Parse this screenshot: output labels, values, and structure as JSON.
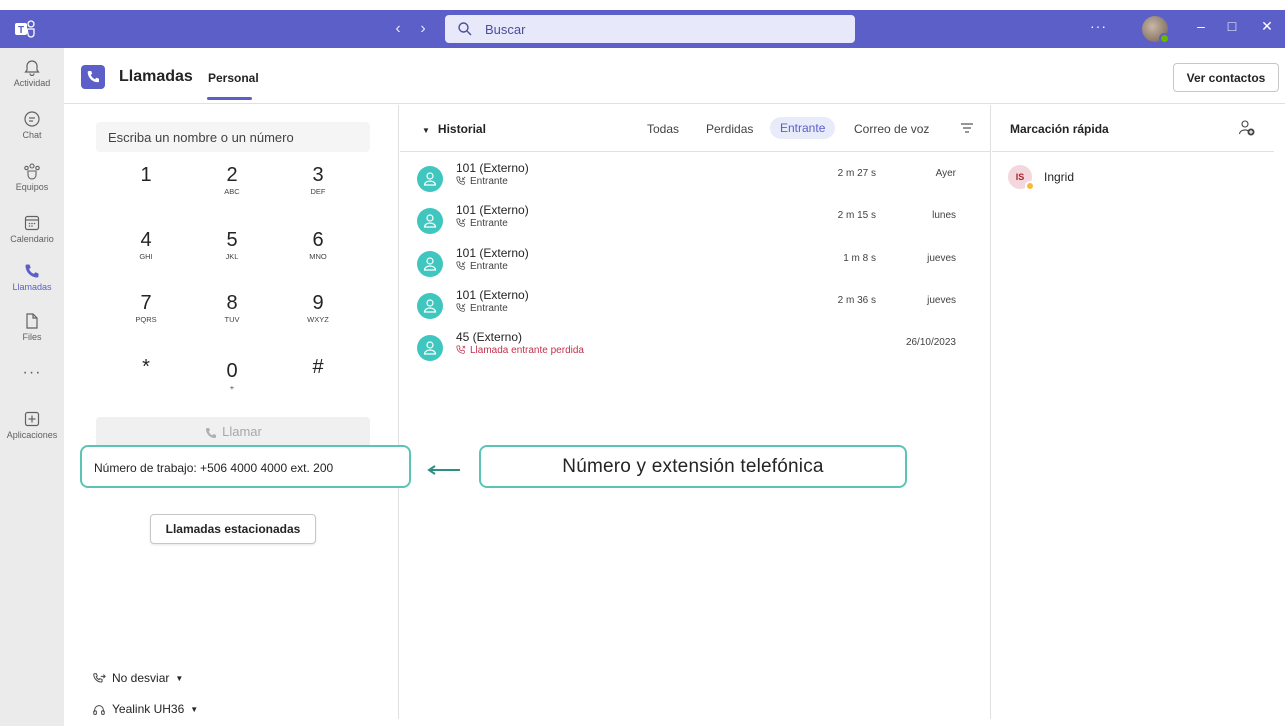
{
  "titlebar": {
    "search_placeholder": "Buscar",
    "more_label": "···",
    "minimize": "–",
    "maximize": "□",
    "close": "✕"
  },
  "rail": {
    "items": [
      {
        "label": "Actividad",
        "icon": "bell-icon"
      },
      {
        "label": "Chat",
        "icon": "chat-icon"
      },
      {
        "label": "Equipos",
        "icon": "teams-icon"
      },
      {
        "label": "Calendario",
        "icon": "calendar-icon"
      },
      {
        "label": "Llamadas",
        "icon": "phone-icon",
        "active": true
      },
      {
        "label": "Files",
        "icon": "file-icon"
      },
      {
        "label": "Aplicaciones",
        "icon": "add-app-icon"
      }
    ],
    "more_label": "···"
  },
  "header": {
    "title": "Llamadas",
    "tab": "Personal",
    "contacts_button": "Ver contactos"
  },
  "dialer": {
    "input_placeholder": "Escriba un nombre o un número",
    "keys": [
      {
        "digit": "1",
        "letters": ""
      },
      {
        "digit": "2",
        "letters": "ABC"
      },
      {
        "digit": "3",
        "letters": "DEF"
      },
      {
        "digit": "4",
        "letters": "GHI"
      },
      {
        "digit": "5",
        "letters": "JKL"
      },
      {
        "digit": "6",
        "letters": "MNO"
      },
      {
        "digit": "7",
        "letters": "PQRS"
      },
      {
        "digit": "8",
        "letters": "TUV"
      },
      {
        "digit": "9",
        "letters": "WXYZ"
      },
      {
        "digit": "*",
        "letters": ""
      },
      {
        "digit": "0",
        "letters": "+"
      },
      {
        "digit": "#",
        "letters": ""
      }
    ],
    "call_label": "Llamar",
    "work_number": "Número de trabajo: +506 4000 4000 ext. 200",
    "parked_button": "Llamadas estacionadas",
    "forwarding": "No desviar",
    "device": "Yealink UH36"
  },
  "callout": {
    "text": "Número y extensión telefónica"
  },
  "history": {
    "title": "Historial",
    "filters": [
      "Todas",
      "Perdidas",
      "Entrante",
      "Correo de voz"
    ],
    "active_filter": "Entrante",
    "rows": [
      {
        "name": "101 (Externo)",
        "type": "Entrante",
        "duration": "2 m 27 s",
        "date": "Ayer",
        "missed": false
      },
      {
        "name": "101 (Externo)",
        "type": "Entrante",
        "duration": "2 m 15 s",
        "date": "lunes",
        "missed": false
      },
      {
        "name": "101 (Externo)",
        "type": "Entrante",
        "duration": "1 m 8 s",
        "date": "jueves",
        "missed": false
      },
      {
        "name": "101 (Externo)",
        "type": "Entrante",
        "duration": "2 m 36 s",
        "date": "jueves",
        "missed": false
      },
      {
        "name": "45 (Externo)",
        "type": "Llamada entrante perdida",
        "duration": "",
        "date": "26/10/2023",
        "missed": true
      }
    ]
  },
  "speed_dial": {
    "title": "Marcación rápida",
    "contacts": [
      {
        "initials": "IS",
        "name": "Ingrid",
        "status": "away"
      }
    ]
  },
  "colors": {
    "brand": "#5b5fc7",
    "avatar_teal": "#3fc6bf",
    "missed_red": "#c4314b",
    "callout_border": "#5cc4b4"
  }
}
